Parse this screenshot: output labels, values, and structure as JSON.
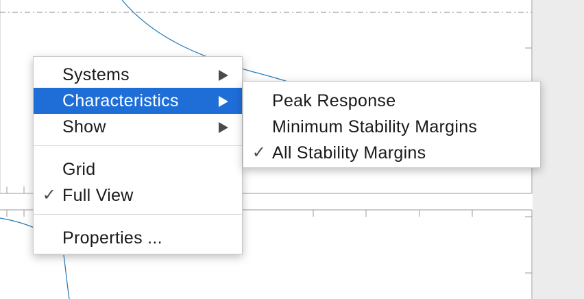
{
  "menu": {
    "items": [
      {
        "label": "Systems",
        "has_submenu": true,
        "checked": false
      },
      {
        "label": "Characteristics",
        "has_submenu": true,
        "checked": false,
        "highlighted": true
      },
      {
        "label": "Show",
        "has_submenu": true,
        "checked": false
      },
      {
        "label": "Grid",
        "has_submenu": false,
        "checked": false
      },
      {
        "label": "Full View",
        "has_submenu": false,
        "checked": true
      },
      {
        "label": "Properties ...",
        "has_submenu": false,
        "checked": false
      }
    ],
    "check_glyph": "✓"
  },
  "submenu": {
    "items": [
      {
        "label": "Peak Response",
        "checked": false
      },
      {
        "label": "Minimum Stability Margins",
        "checked": false
      },
      {
        "label": "All Stability Margins",
        "checked": true
      }
    ]
  },
  "colors": {
    "highlight": "#1f6ed8",
    "curve": "#1f77b4",
    "panel_bg": "#ececec"
  }
}
